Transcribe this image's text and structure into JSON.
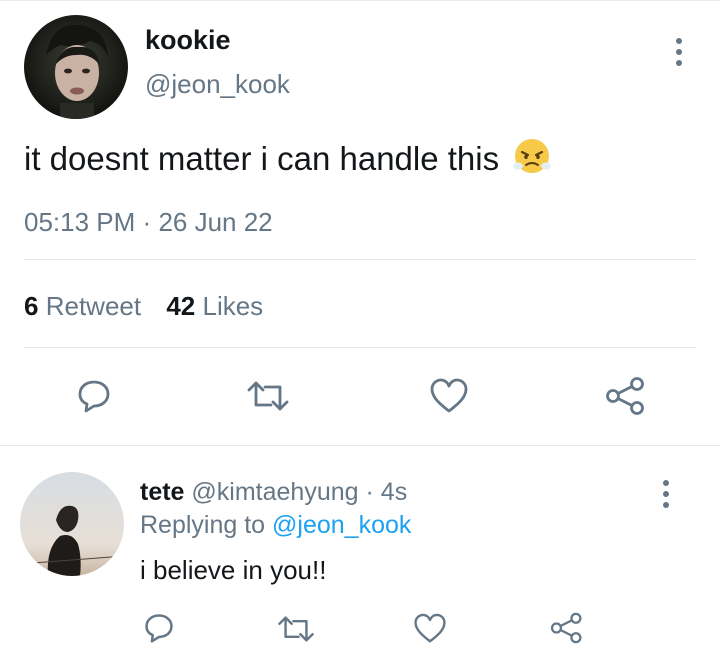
{
  "main_tweet": {
    "display_name": "kookie",
    "handle": "@jeon_kook",
    "text": "it doesnt matter i can handle this",
    "emoji": "😤",
    "time": "05:13 PM",
    "separator": "·",
    "date": "26 Jun 22",
    "retweet_count": "6",
    "retweet_label": "Retweet",
    "likes_count": "42",
    "likes_label": "Likes"
  },
  "reply": {
    "display_name": "tete",
    "handle": "@kimtaehyung",
    "separator": "·",
    "age": "4s",
    "replying_prefix": "Replying to",
    "replying_handle": "@jeon_kook",
    "text": "i believe in you!!"
  },
  "colors": {
    "accent": "#1da1f2",
    "secondary_text": "#657786",
    "divider": "#e1e8ed",
    "emoji_face": "#f7c948"
  },
  "icons": [
    "more-vertical-icon",
    "reply-icon",
    "retweet-icon",
    "like-heart-icon",
    "share-icon"
  ]
}
